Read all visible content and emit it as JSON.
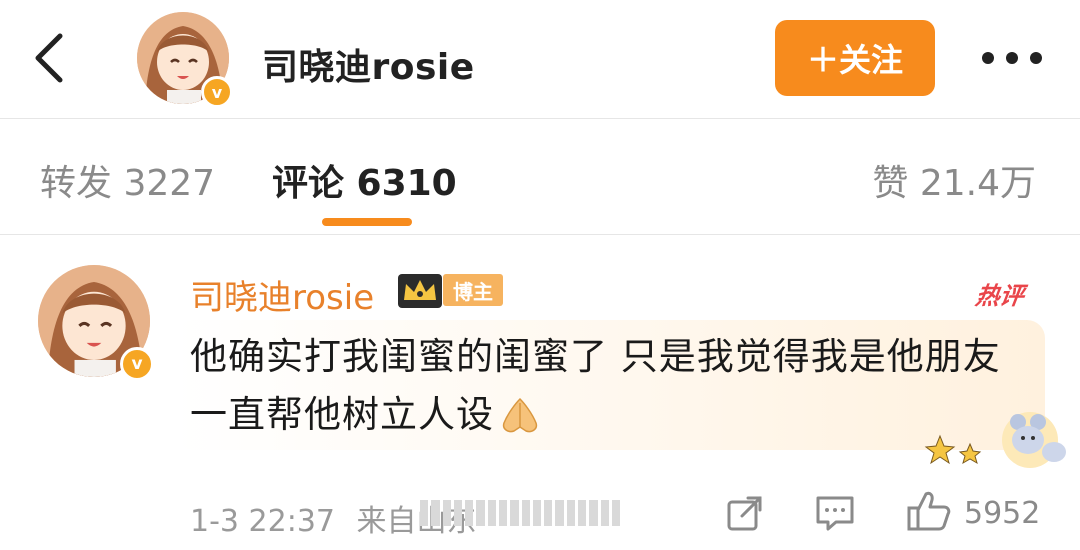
{
  "header": {
    "back_icon": "chevron-left-icon",
    "author_name": "司晓迪rosie",
    "verified_badge": "v",
    "follow_label": "＋关注",
    "more_icon": "more-dots-icon",
    "accent_color": "#f78b1d"
  },
  "tabs": {
    "repost": "转发 3227",
    "comment": "评论 6310",
    "like": "赞 21.4万",
    "active": "comment"
  },
  "comment": {
    "author_name": "司晓迪rosie",
    "verified_badge": "v",
    "crown_icon": "crown-icon",
    "owner_badge": "博主",
    "hot_badge": "热评",
    "text": "他确实打我闺蜜的闺蜜了 只是我觉得我是他朋友 一直帮他树立人设",
    "emoji": "praying-hands-icon",
    "timestamp": "1-3 22:37",
    "source": "来自山东",
    "like_count": "5952",
    "name_color": "#e8812b"
  }
}
